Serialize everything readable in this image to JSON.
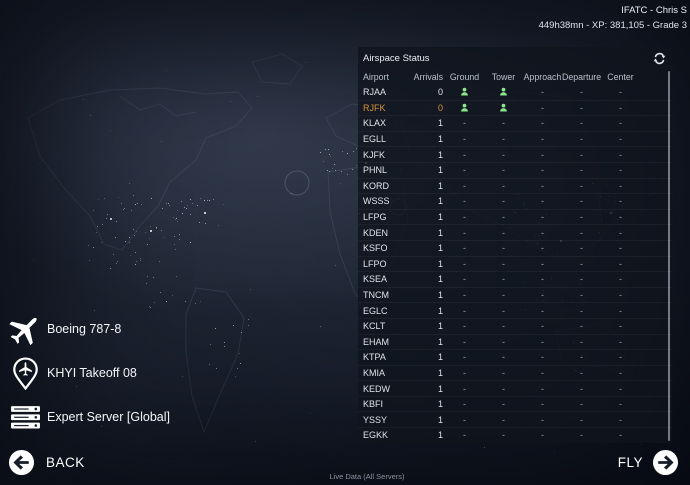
{
  "account": {
    "name_line": "IFATC - Chris S",
    "stats_line": "449h38mn - XP: 381,105 - Grade 3"
  },
  "airspace_panel": {
    "title": "Airspace Status",
    "refresh_icon": "refresh-icon",
    "columns": [
      "Airport",
      "Arrivals",
      "Ground",
      "Tower",
      "Approach",
      "Departure",
      "Center"
    ],
    "rows": [
      {
        "airport": "RJAA",
        "arrivals": "0",
        "ground": "atc",
        "tower": "atc",
        "approach": "-",
        "departure": "-",
        "center": "-",
        "highlight": false
      },
      {
        "airport": "RJFK",
        "arrivals": "0",
        "ground": "atc",
        "tower": "atc",
        "approach": "-",
        "departure": "-",
        "center": "-",
        "highlight": true
      },
      {
        "airport": "KLAX",
        "arrivals": "1",
        "ground": "-",
        "tower": "-",
        "approach": "-",
        "departure": "-",
        "center": "-",
        "highlight": false
      },
      {
        "airport": "EGLL",
        "arrivals": "1",
        "ground": "-",
        "tower": "-",
        "approach": "-",
        "departure": "-",
        "center": "-",
        "highlight": false
      },
      {
        "airport": "KJFK",
        "arrivals": "1",
        "ground": "-",
        "tower": "-",
        "approach": "-",
        "departure": "-",
        "center": "-",
        "highlight": false
      },
      {
        "airport": "PHNL",
        "arrivals": "1",
        "ground": "-",
        "tower": "-",
        "approach": "-",
        "departure": "-",
        "center": "-",
        "highlight": false
      },
      {
        "airport": "KORD",
        "arrivals": "1",
        "ground": "-",
        "tower": "-",
        "approach": "-",
        "departure": "-",
        "center": "-",
        "highlight": false
      },
      {
        "airport": "WSSS",
        "arrivals": "1",
        "ground": "-",
        "tower": "-",
        "approach": "-",
        "departure": "-",
        "center": "-",
        "highlight": false
      },
      {
        "airport": "LFPG",
        "arrivals": "1",
        "ground": "-",
        "tower": "-",
        "approach": "-",
        "departure": "-",
        "center": "-",
        "highlight": false
      },
      {
        "airport": "KDEN",
        "arrivals": "1",
        "ground": "-",
        "tower": "-",
        "approach": "-",
        "departure": "-",
        "center": "-",
        "highlight": false
      },
      {
        "airport": "KSFO",
        "arrivals": "1",
        "ground": "-",
        "tower": "-",
        "approach": "-",
        "departure": "-",
        "center": "-",
        "highlight": false
      },
      {
        "airport": "LFPO",
        "arrivals": "1",
        "ground": "-",
        "tower": "-",
        "approach": "-",
        "departure": "-",
        "center": "-",
        "highlight": false
      },
      {
        "airport": "KSEA",
        "arrivals": "1",
        "ground": "-",
        "tower": "-",
        "approach": "-",
        "departure": "-",
        "center": "-",
        "highlight": false
      },
      {
        "airport": "TNCM",
        "arrivals": "1",
        "ground": "-",
        "tower": "-",
        "approach": "-",
        "departure": "-",
        "center": "-",
        "highlight": false
      },
      {
        "airport": "EGLC",
        "arrivals": "1",
        "ground": "-",
        "tower": "-",
        "approach": "-",
        "departure": "-",
        "center": "-",
        "highlight": false
      },
      {
        "airport": "KCLT",
        "arrivals": "1",
        "ground": "-",
        "tower": "-",
        "approach": "-",
        "departure": "-",
        "center": "-",
        "highlight": false
      },
      {
        "airport": "EHAM",
        "arrivals": "1",
        "ground": "-",
        "tower": "-",
        "approach": "-",
        "departure": "-",
        "center": "-",
        "highlight": false
      },
      {
        "airport": "KTPA",
        "arrivals": "1",
        "ground": "-",
        "tower": "-",
        "approach": "-",
        "departure": "-",
        "center": "-",
        "highlight": false
      },
      {
        "airport": "KMIA",
        "arrivals": "1",
        "ground": "-",
        "tower": "-",
        "approach": "-",
        "departure": "-",
        "center": "-",
        "highlight": false
      },
      {
        "airport": "KEDW",
        "arrivals": "1",
        "ground": "-",
        "tower": "-",
        "approach": "-",
        "departure": "-",
        "center": "-",
        "highlight": false
      },
      {
        "airport": "KBFI",
        "arrivals": "1",
        "ground": "-",
        "tower": "-",
        "approach": "-",
        "departure": "-",
        "center": "-",
        "highlight": false
      },
      {
        "airport": "YSSY",
        "arrivals": "1",
        "ground": "-",
        "tower": "-",
        "approach": "-",
        "departure": "-",
        "center": "-",
        "highlight": false
      },
      {
        "airport": "EGKK",
        "arrivals": "1",
        "ground": "-",
        "tower": "-",
        "approach": "-",
        "departure": "-",
        "center": "-",
        "highlight": false
      }
    ]
  },
  "flight_summary": {
    "aircraft": "Boeing 787-8",
    "departure": "KHYI Takeoff 08",
    "server": "Expert Server [Global]"
  },
  "footer": {
    "back_label": "BACK",
    "fly_label": "FLY",
    "live_data_label": "Live Data (All Servers)"
  },
  "colors": {
    "highlight_orange": "#d79435",
    "atc_active_green": "#8ce68c",
    "background_navy": "#1a2130",
    "panel_bg": "rgba(15,20,29,0.80)"
  }
}
